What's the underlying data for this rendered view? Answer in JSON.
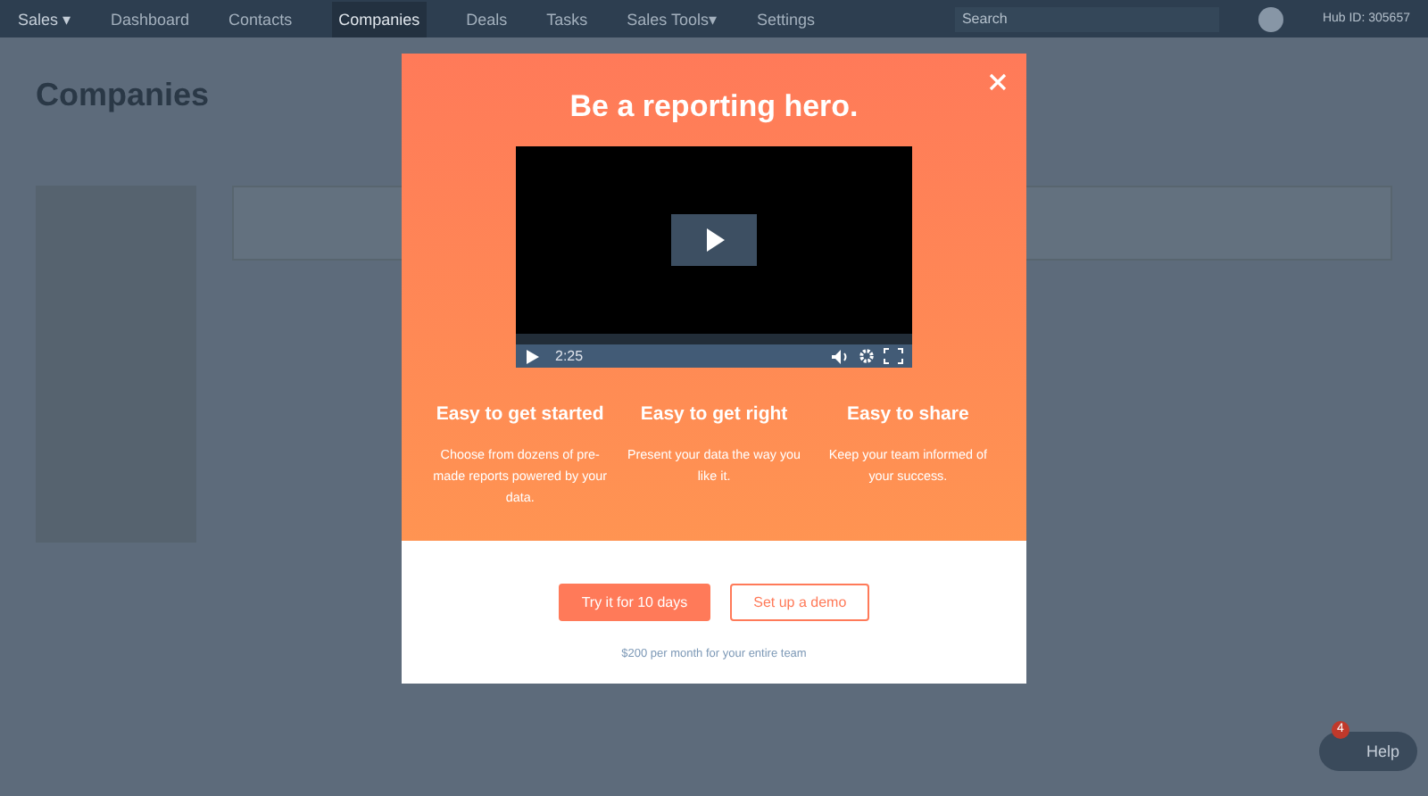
{
  "nav": {
    "brand": "Sales",
    "brand_caret": "▾",
    "items": [
      {
        "label": "Dashboard",
        "selected": false
      },
      {
        "label": "Contacts",
        "selected": false
      },
      {
        "label": "Companies",
        "selected": true
      },
      {
        "label": "Deals",
        "selected": false
      },
      {
        "label": "Tasks",
        "selected": false
      },
      {
        "label": "Sales Tools",
        "selected": false,
        "caret": "▾"
      },
      {
        "label": "Settings",
        "selected": false
      }
    ],
    "search": {
      "placeholder": "Search"
    },
    "account": "Hub ID: 305657"
  },
  "page": {
    "title": "Companies"
  },
  "modal": {
    "title": "Be a reporting hero.",
    "video": {
      "time": "2:25"
    },
    "features": [
      {
        "title": "Easy to get started",
        "text": "Choose from dozens of pre-made reports powered by your data."
      },
      {
        "title": "Easy to get right",
        "text": "Present your data the way you like it."
      },
      {
        "title": "Easy to share",
        "text": "Keep your team informed of your success."
      }
    ],
    "primary_button": "Try it for 10 days",
    "secondary_button": "Set up a demo",
    "footnote": "$200 per month for your entire team"
  },
  "help": {
    "label": "Help",
    "badge": "4"
  }
}
